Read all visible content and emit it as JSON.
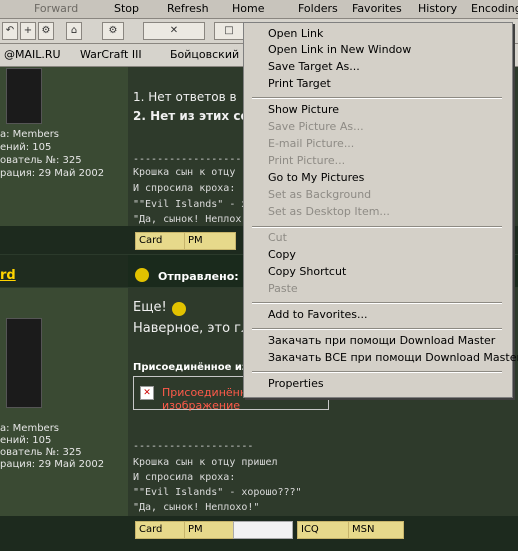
{
  "toolbar": {
    "buttons": [
      {
        "label": "Forward",
        "disabled": true
      },
      {
        "label": "Stop"
      },
      {
        "label": "Refresh"
      },
      {
        "label": "Home"
      },
      {
        "label": "Folders"
      },
      {
        "label": "Favorites"
      },
      {
        "label": "History"
      },
      {
        "label": "Encoding"
      }
    ]
  },
  "links": [
    "@MAIL.RU",
    "WarCraft III",
    "Бойцовский"
  ],
  "post1": {
    "profile": {
      "group": "а: Members",
      "posts": "ений: 105",
      "user_num": "ователь №: 325",
      "reg": "рация: 29 Май 2002"
    },
    "poll_lines": [
      "1. Нет ответов в",
      "2. Нет из этих со"
    ],
    "sig_sep": "--------------------",
    "sig_lines": [
      "Крошка сын к отцу",
      "И спросила кроха:",
      "\"\"Evil Islands\" - хор",
      "\"Да, сынок! Неплох"
    ],
    "buttons": [
      "Card",
      "PM"
    ]
  },
  "post2": {
    "author": "rd",
    "sent_label": "Отправлено: 2",
    "lines": [
      "Еще!",
      "Наверное, это гл"
    ],
    "attach_label": "Присоединённое изоб",
    "attach_link": "Присоединённое изображение",
    "profile": {
      "group": "а: Members",
      "posts": "ений: 105",
      "user_num": "ователь №: 325",
      "reg": "рация: 29 Май 2002"
    },
    "sig_sep": "--------------------",
    "sig_lines": [
      "Крошка сын к отцу пришел",
      "И спросила кроха:",
      "\"\"Evil Islands\" - хорошо???\"",
      "\"Да, сынок! Неплохо!\""
    ],
    "buttons": [
      "Card",
      "PM",
      "ICQ",
      "MSN"
    ]
  },
  "menu": {
    "items": [
      {
        "label": "Open Link"
      },
      {
        "label": "Open Link in New Window"
      },
      {
        "label": "Save Target As..."
      },
      {
        "label": "Print Target"
      },
      {
        "label": "Show Picture"
      },
      {
        "label": "Save Picture As...",
        "disabled": true
      },
      {
        "label": "E-mail Picture...",
        "disabled": true
      },
      {
        "label": "Print Picture...",
        "disabled": true
      },
      {
        "label": "Go to My Pictures"
      },
      {
        "label": "Set as Background",
        "disabled": true
      },
      {
        "label": "Set as Desktop Item...",
        "disabled": true
      },
      {
        "label": "Cut",
        "disabled": true
      },
      {
        "label": "Copy"
      },
      {
        "label": "Copy Shortcut"
      },
      {
        "label": "Paste",
        "disabled": true
      },
      {
        "label": "Add to Favorites..."
      },
      {
        "label": "Закачать при помощи Download Master"
      },
      {
        "label": "Закачать ВСЕ при помощи Download Master"
      },
      {
        "label": "Properties"
      }
    ]
  }
}
